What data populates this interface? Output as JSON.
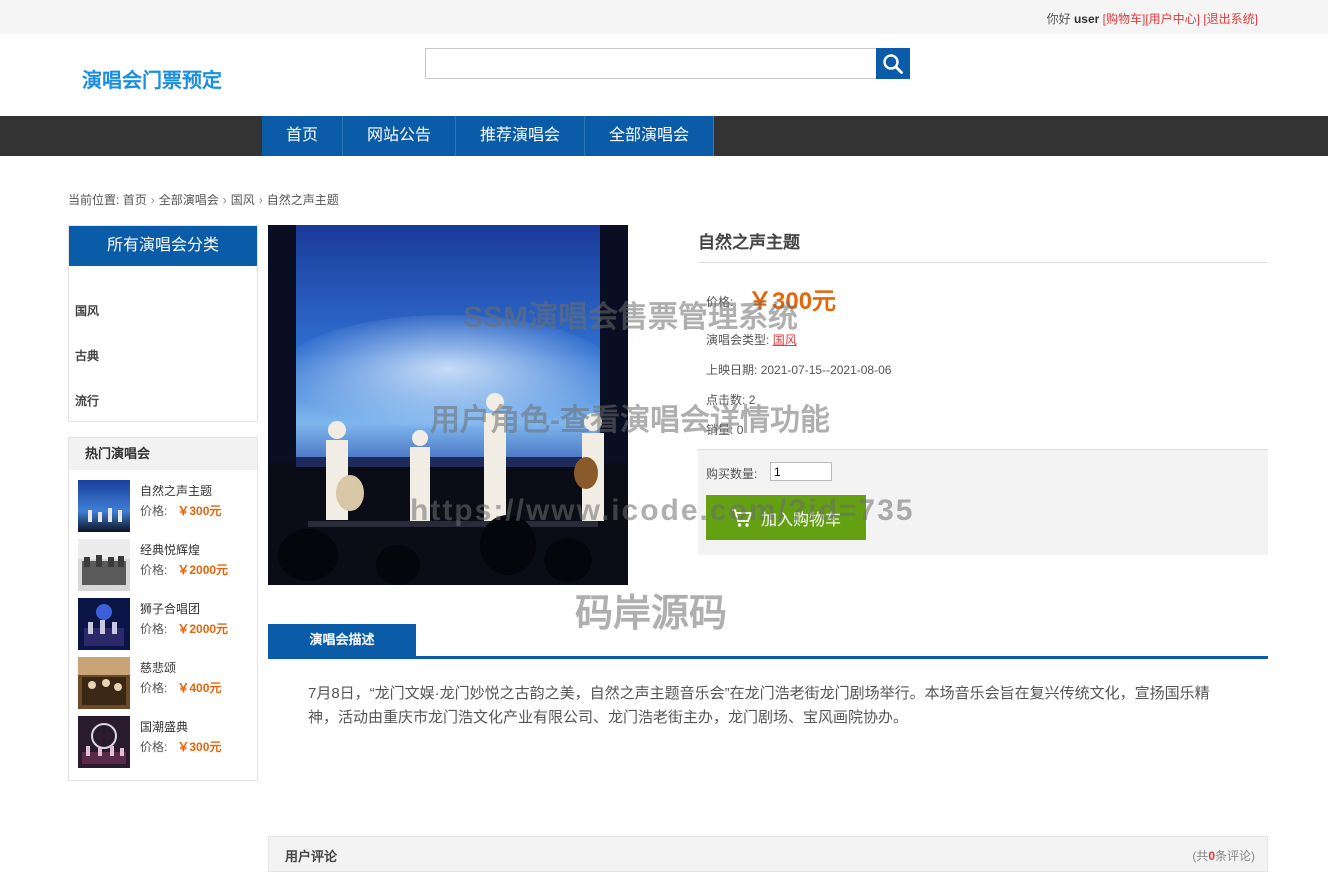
{
  "topbar": {
    "greeting": "你好",
    "username": "user",
    "cart_link": "[购物车]",
    "user_center_link": "[用户中心]",
    "logout_link": "[退出系统]"
  },
  "header": {
    "logo": "演唱会门票预定",
    "search_placeholder": ""
  },
  "nav": {
    "items": [
      "首页",
      "网站公告",
      "推荐演唱会",
      "全部演唱会"
    ]
  },
  "breadcrumb": {
    "prefix": "当前位置:",
    "items": [
      "首页",
      "全部演唱会",
      "国风",
      "自然之声主题"
    ]
  },
  "sidebar": {
    "categories_title": "所有演唱会分类",
    "categories": [
      "国风",
      "古典",
      "流行"
    ],
    "hot_title": "热门演唱会",
    "price_label": "价格:",
    "hot_items": [
      {
        "name": "自然之声主题",
        "price": "￥300元"
      },
      {
        "name": "经典悦辉煌",
        "price": "￥2000元"
      },
      {
        "name": "狮子合唱团",
        "price": "￥2000元"
      },
      {
        "name": "慈悲颂",
        "price": "￥400元"
      },
      {
        "name": "国潮盛典",
        "price": "￥300元"
      }
    ]
  },
  "product": {
    "title": "自然之声主题",
    "price_label": "价格:",
    "price": "￥300元",
    "type_label": "演唱会类型:",
    "type_value": "国风",
    "date_label": "上映日期:",
    "date_value": "2021-07-15--2021-08-06",
    "clicks_label": "点击数:",
    "clicks_value": "2",
    "sales_label": "销量:",
    "sales_value": "0",
    "qty_label": "购买数量:",
    "qty_value": "1",
    "cart_button": "加入购物车"
  },
  "description": {
    "tab": "演唱会描述",
    "text": "7月8日，“龙门文娱·龙门妙悦之古韵之美，自然之声主题音乐会”在龙门浩老街龙门剧场举行。本场音乐会旨在复兴传统文化，宣扬国乐精神，活动由重庆市龙门浩文化产业有限公司、龙门浩老街主办，龙门剧场、宝风画院协办。"
  },
  "comments": {
    "title": "用户评论",
    "count_prefix": "(共",
    "count": "0",
    "count_suffix": "条评论)"
  },
  "watermarks": {
    "line1": "SSM演唱会售票管理系统",
    "line2": "用户角色-查看演唱会详情功能",
    "line3": "https://www.icode.com/?id=735",
    "line4": "码岸源码"
  },
  "colors": {
    "primary": "#0a5ba8",
    "nav_bg": "#333333",
    "price": "#e4650a",
    "link": "#e4393c",
    "cart_button": "#63a112",
    "logo": "#1a8ee0"
  }
}
